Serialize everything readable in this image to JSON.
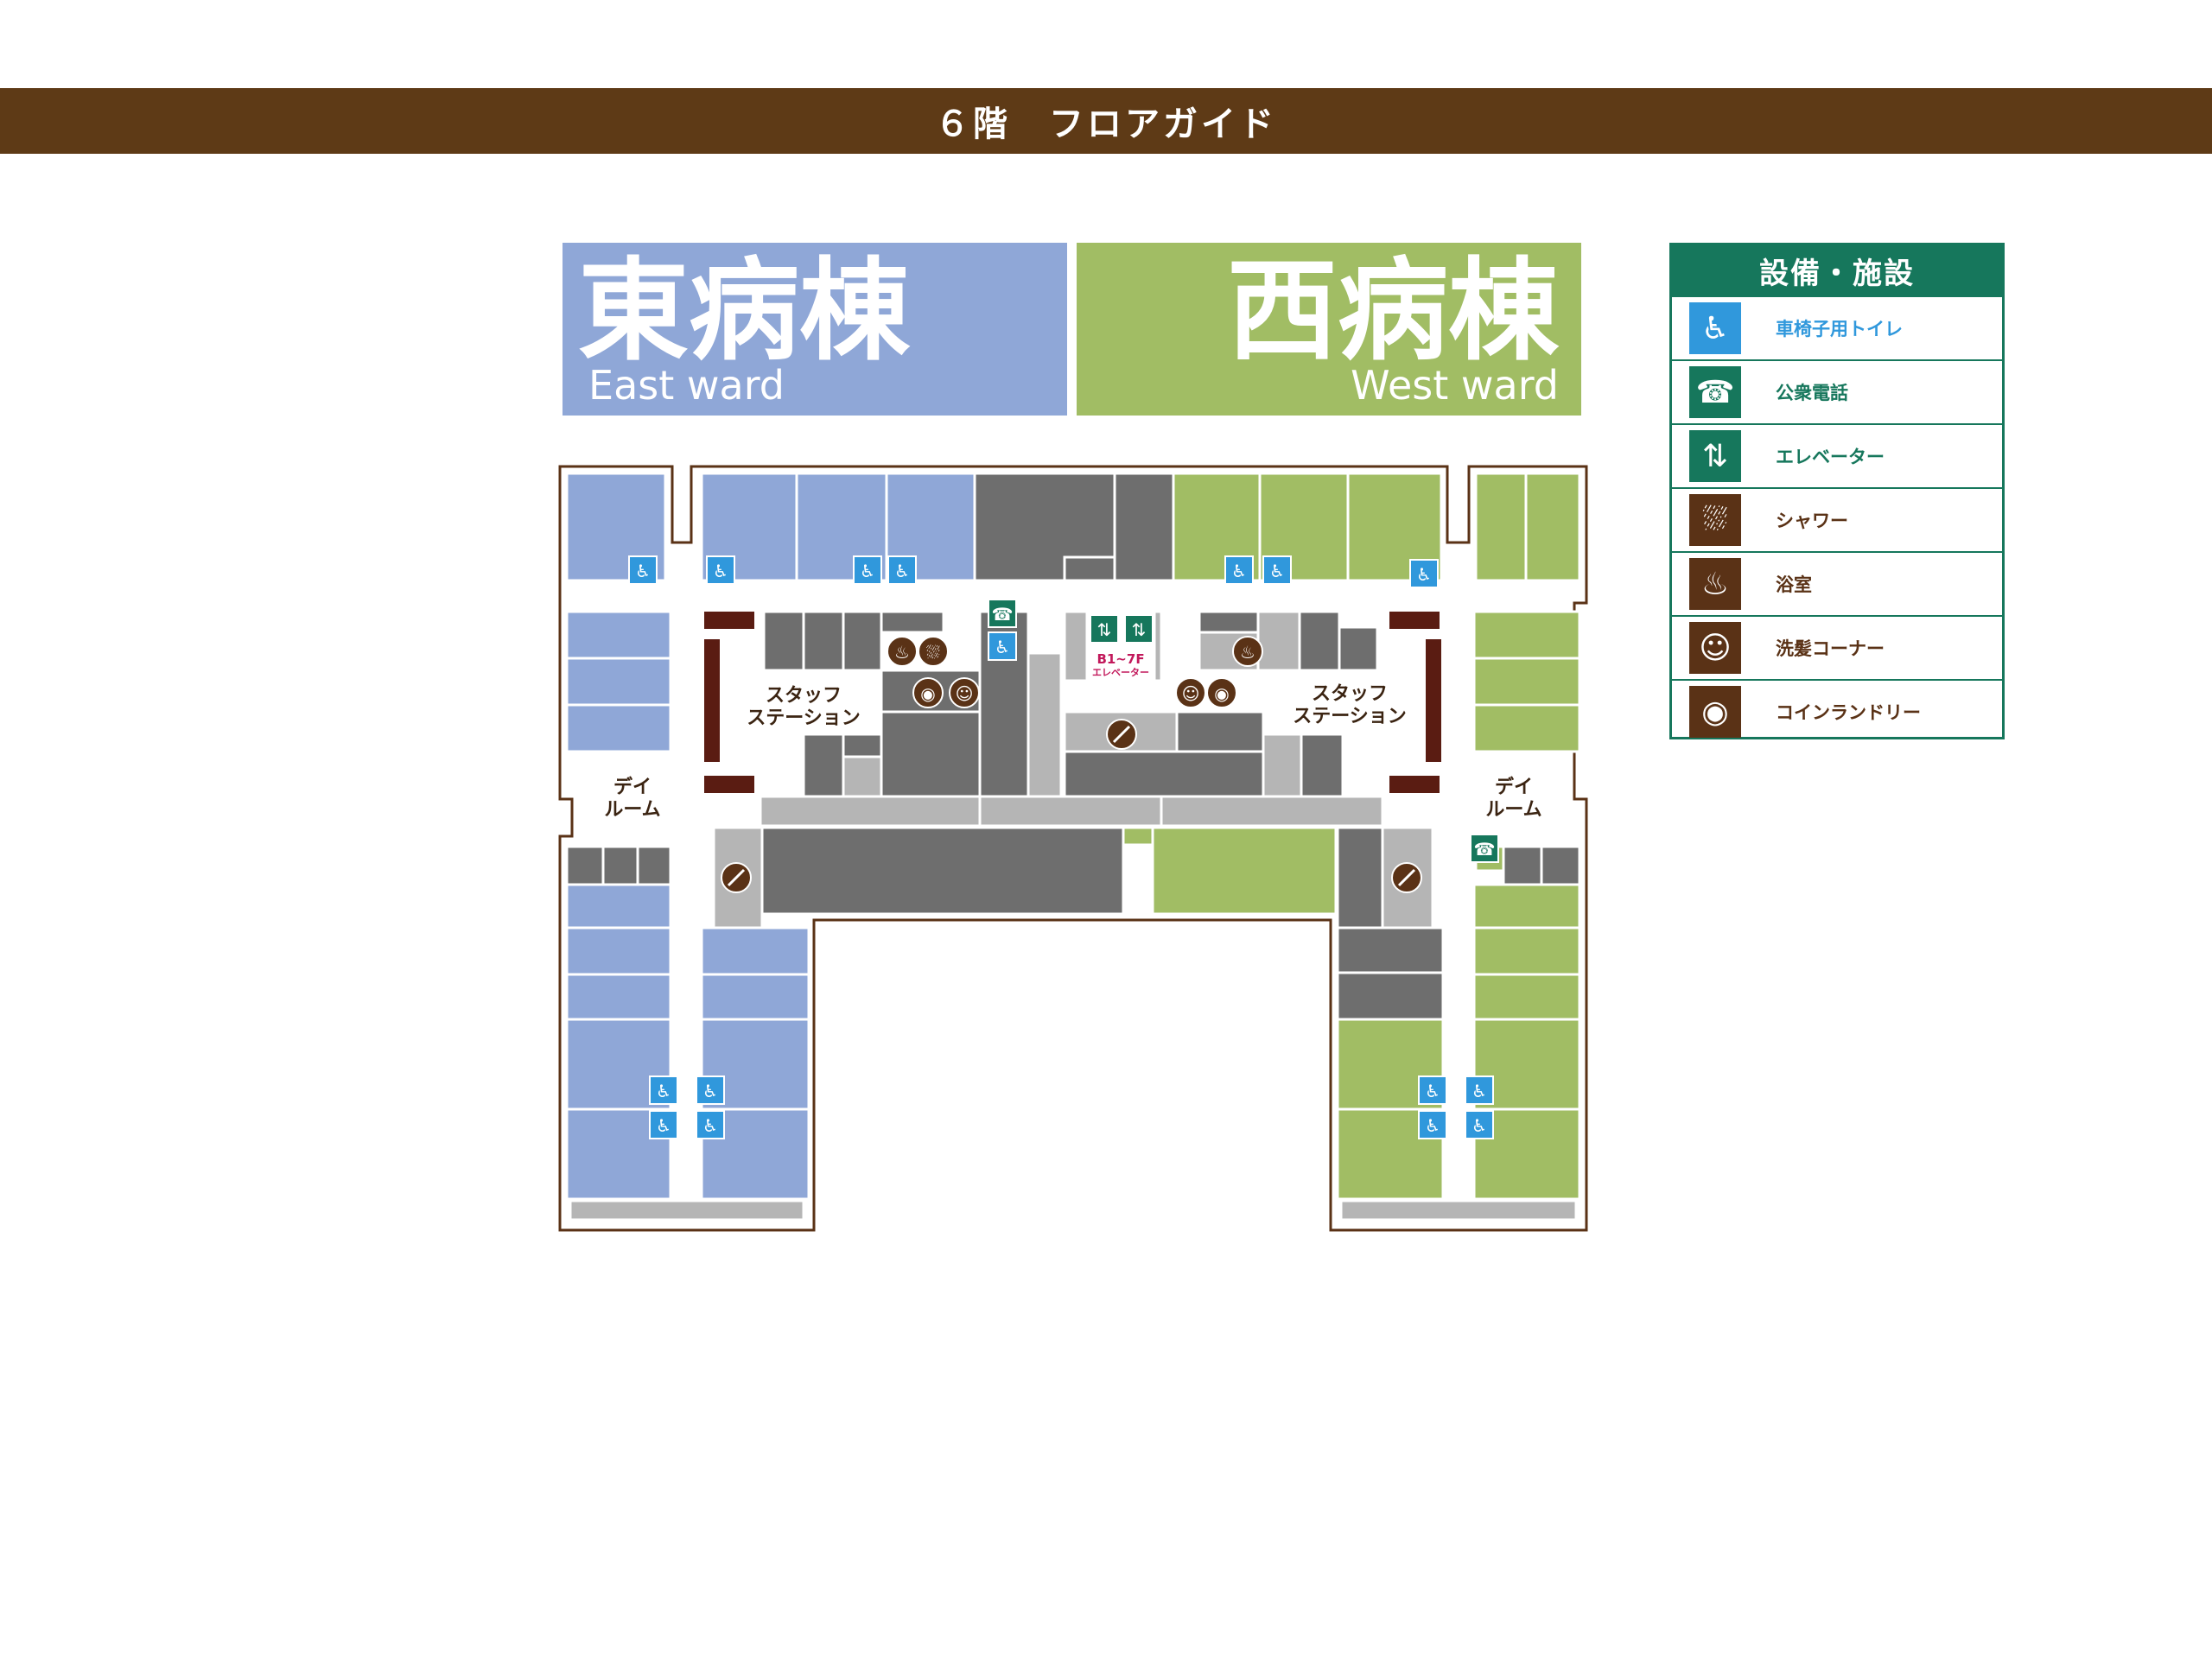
{
  "header": {
    "title": "６階　フロアガイド"
  },
  "wards": {
    "east": {
      "jp": "東病棟",
      "en": "East ward"
    },
    "west": {
      "jp": "西病棟",
      "en": "West ward"
    }
  },
  "legend": {
    "title": "設備・施設",
    "items": [
      {
        "label": "車椅子用トイレ",
        "icon": "wheelchair-icon",
        "color": "#3098dc",
        "text_color": "#3098dc"
      },
      {
        "label": "公衆電話",
        "icon": "phone-icon",
        "color": "#16775c",
        "text_color": "#16775c"
      },
      {
        "label": "エレベーター",
        "icon": "elevator-icon",
        "color": "#16775c",
        "text_color": "#16775c"
      },
      {
        "label": "シャワー",
        "icon": "shower-icon",
        "color": "#5a3216",
        "text_color": "#5a3216"
      },
      {
        "label": "浴室",
        "icon": "bath-icon",
        "color": "#5a3216",
        "text_color": "#5a3216"
      },
      {
        "label": "洗髪コーナー",
        "icon": "hair-wash-icon",
        "color": "#5a3216",
        "text_color": "#5a3216"
      },
      {
        "label": "コインランドリー",
        "icon": "coin-laundry-icon",
        "color": "#5a3216",
        "text_color": "#5a3216"
      }
    ]
  },
  "map": {
    "staff_station": {
      "line1": "スタッフ",
      "line2": "ステーション"
    },
    "dayroom": {
      "line1": "デイ",
      "line2": "ルーム"
    },
    "elevator_floors": "B1~7F",
    "elevator_label": "エレベーター"
  },
  "colors": {
    "east": "#8fa7d7",
    "west": "#a1bd64",
    "core": "#6e6e6e",
    "corridor": "#b5b5b5",
    "outline": "#5a3216",
    "station": "#5a1c12",
    "header": "#5e3a16"
  }
}
